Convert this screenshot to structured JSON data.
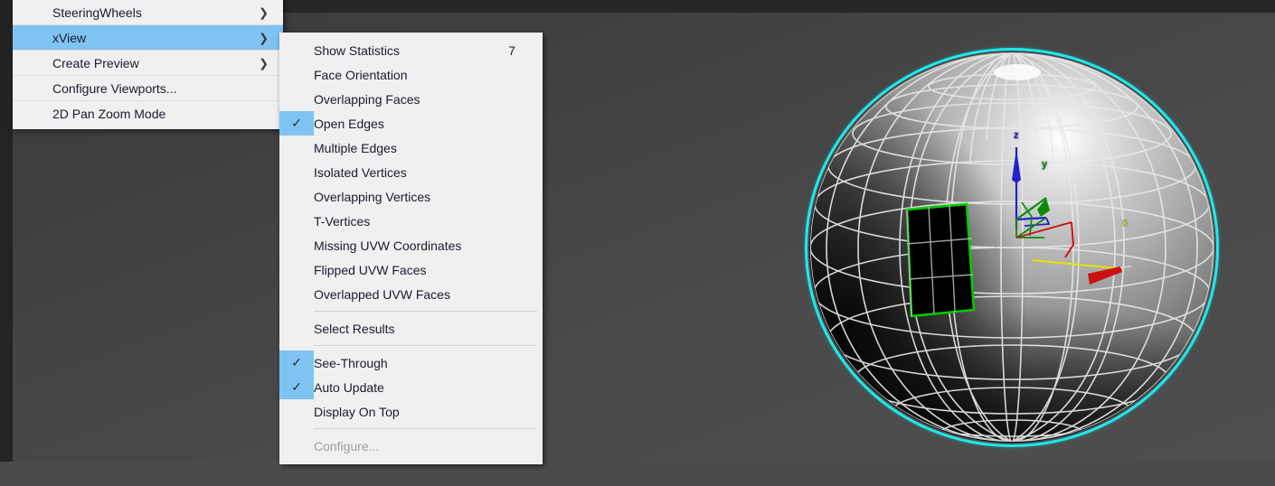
{
  "app": {
    "context": "3ds Max viewport quad/right-click menu",
    "viewport_background": "#474747",
    "selection_outline_color": "#1ce9ee",
    "open_edges_highlight_color": "#00cc00",
    "menu_background": "#f0f0f0",
    "menu_highlight_color": "#7fc3f2"
  },
  "left_menu": {
    "items": [
      {
        "label": "SteeringWheels",
        "has_submenu": true,
        "submenu_arrow": "chevron-right-icon",
        "selected": false,
        "separator_below": true
      },
      {
        "label": "xView",
        "has_submenu": true,
        "submenu_arrow": "chevron-right-icon",
        "selected": true,
        "separator_below": true
      },
      {
        "label": "Create Preview",
        "has_submenu": true,
        "submenu_arrow": "chevron-right-icon",
        "selected": false,
        "separator_below": true
      },
      {
        "label": "Configure Viewports...",
        "has_submenu": false,
        "submenu_arrow": "",
        "selected": false,
        "separator_below": true
      },
      {
        "label": "2D Pan Zoom Mode",
        "has_submenu": false,
        "submenu_arrow": "",
        "selected": false,
        "separator_below": false
      }
    ]
  },
  "xview_submenu": {
    "title": "xView",
    "groups": [
      {
        "items": [
          {
            "label": "Show Statistics",
            "checked": false,
            "shortcut": "7",
            "disabled": false
          },
          {
            "label": "Face Orientation",
            "checked": false,
            "shortcut": "",
            "disabled": false
          },
          {
            "label": "Overlapping Faces",
            "checked": false,
            "shortcut": "",
            "disabled": false
          },
          {
            "label": "Open Edges",
            "checked": true,
            "shortcut": "",
            "disabled": false
          },
          {
            "label": "Multiple Edges",
            "checked": false,
            "shortcut": "",
            "disabled": false
          },
          {
            "label": "Isolated Vertices",
            "checked": false,
            "shortcut": "",
            "disabled": false
          },
          {
            "label": "Overlapping Vertices",
            "checked": false,
            "shortcut": "",
            "disabled": false
          },
          {
            "label": "T-Vertices",
            "checked": false,
            "shortcut": "",
            "disabled": false
          },
          {
            "label": "Missing UVW Coordinates",
            "checked": false,
            "shortcut": "",
            "disabled": false
          },
          {
            "label": "Flipped UVW Faces",
            "checked": false,
            "shortcut": "",
            "disabled": false
          },
          {
            "label": "Overlapped UVW Faces",
            "checked": false,
            "shortcut": "",
            "disabled": false
          }
        ]
      },
      {
        "items": [
          {
            "label": "Select Results",
            "checked": false,
            "shortcut": "",
            "disabled": false
          }
        ]
      },
      {
        "items": [
          {
            "label": "See-Through",
            "checked": true,
            "shortcut": "",
            "disabled": false
          },
          {
            "label": "Auto Update",
            "checked": true,
            "shortcut": "",
            "disabled": false
          },
          {
            "label": "Display On Top",
            "checked": false,
            "shortcut": "",
            "disabled": false
          }
        ]
      },
      {
        "items": [
          {
            "label": "Configure...",
            "checked": false,
            "shortcut": "",
            "disabled": true
          }
        ]
      }
    ],
    "check_glyph": "✓"
  },
  "viewport_scene": {
    "object": "sphere",
    "selected": true,
    "gizmo": {
      "type": "move-transform-gizmo",
      "axes": [
        {
          "name": "z",
          "label": "Z",
          "color": "#2222c8"
        },
        {
          "name": "y",
          "label": "Y",
          "color": "#0a8a0a"
        },
        {
          "name": "x",
          "label": "X",
          "color": "#d8d232"
        }
      ]
    },
    "xview_result": {
      "check": "Open Edges",
      "highlight_label": "open-edge-region",
      "color": "#00cc00"
    }
  }
}
